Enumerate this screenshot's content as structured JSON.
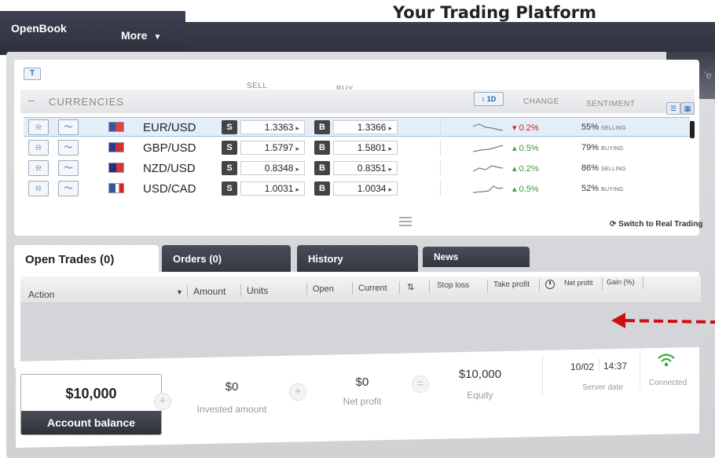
{
  "header": {
    "headline": "Your Trading Platform",
    "brand": "OpenBook",
    "more_label": "More"
  },
  "edge_text": "'e",
  "rates": {
    "filter_icon": "filter-icon",
    "section_title": "CURRENCIES",
    "section_toggle": "–",
    "col_sell": "SELL",
    "col_buy": "BUY",
    "timeframe": "↕ 1D",
    "col_change": "CHANGE",
    "col_sentiment": "SENTIMENT",
    "rows": [
      {
        "pair": "EUR/USD",
        "sell": "1.3363",
        "buy": "1.3366",
        "change": "▾ 0.2%",
        "direction": "down",
        "sentiment_pct": "55%",
        "sentiment_label": "SELLING"
      },
      {
        "pair": "GBP/USD",
        "sell": "1.5797",
        "buy": "1.5801",
        "change": "▴ 0.5%",
        "direction": "up",
        "sentiment_pct": "79%",
        "sentiment_label": "BUYING"
      },
      {
        "pair": "NZD/USD",
        "sell": "0.8348",
        "buy": "0.8351",
        "change": "▴ 0.2%",
        "direction": "up",
        "sentiment_pct": "86%",
        "sentiment_label": "SELLING"
      },
      {
        "pair": "USD/CAD",
        "sell": "1.0031",
        "buy": "1.0034",
        "change": "▴ 0.5%",
        "direction": "up",
        "sentiment_pct": "52%",
        "sentiment_label": "BUYING"
      }
    ],
    "sell_badge": "S",
    "buy_badge": "B",
    "switch_label": "Switch to Real Trading"
  },
  "tabs": {
    "open_trades": "Open Trades (0)",
    "orders": "Orders (0)",
    "history": "History",
    "news": "News"
  },
  "trades_table": {
    "action": "Action",
    "amount": "Amount",
    "units": "Units",
    "open": "Open",
    "current": "Current",
    "sort": "⇅",
    "stop_loss": "Stop loss",
    "take_profit": "Take profit",
    "net_profit": "Net profit",
    "gain": "Gain (%)"
  },
  "summary": {
    "balance_value": "$10,000",
    "balance_label": "Account balance",
    "invested_value": "$0",
    "invested_label": "Invested amount",
    "net_profit_value": "$0",
    "net_profit_label": "Net profit",
    "equity_value": "$10,000",
    "equity_label": "Equity",
    "server_date": "10/02",
    "server_time": "14:37",
    "server_label": "Server date",
    "connection_label": "Connected",
    "plus_sign": "+",
    "equals_sign": "="
  },
  "colors": {
    "up": "#3a9a3a",
    "down": "#cc2222",
    "arrow": "#cc1111",
    "wifi": "#3aa83a"
  }
}
